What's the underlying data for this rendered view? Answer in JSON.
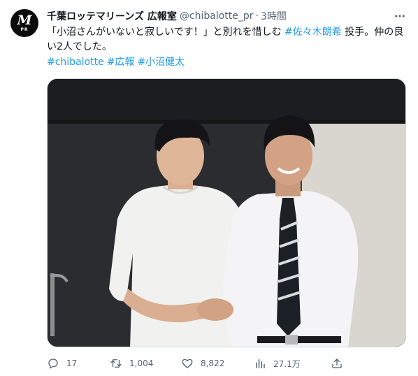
{
  "author": {
    "avatar_mark": "M",
    "avatar_sub": "PR",
    "display_name": "千葉ロッテマリーンズ 広報室",
    "handle": "@chibalotte_pr",
    "separator": "·",
    "time": "3時間"
  },
  "tweet": {
    "text_part1": "「小沼さんがいないと寂しいです！」と別れを惜しむ ",
    "text_tag": "#佐々木朗希",
    "text_part2": " 投手。仲の良い2人でした。",
    "hashtags": [
      "#chibalotte",
      "#広報",
      "#小沼健太"
    ]
  },
  "stats": {
    "replies": "17",
    "retweets": "1,004",
    "likes": "8,822",
    "views": "27.1万"
  },
  "colors": {
    "link": "#1d9bf0",
    "secondary_text": "#536471",
    "primary_text": "#0f1419"
  }
}
